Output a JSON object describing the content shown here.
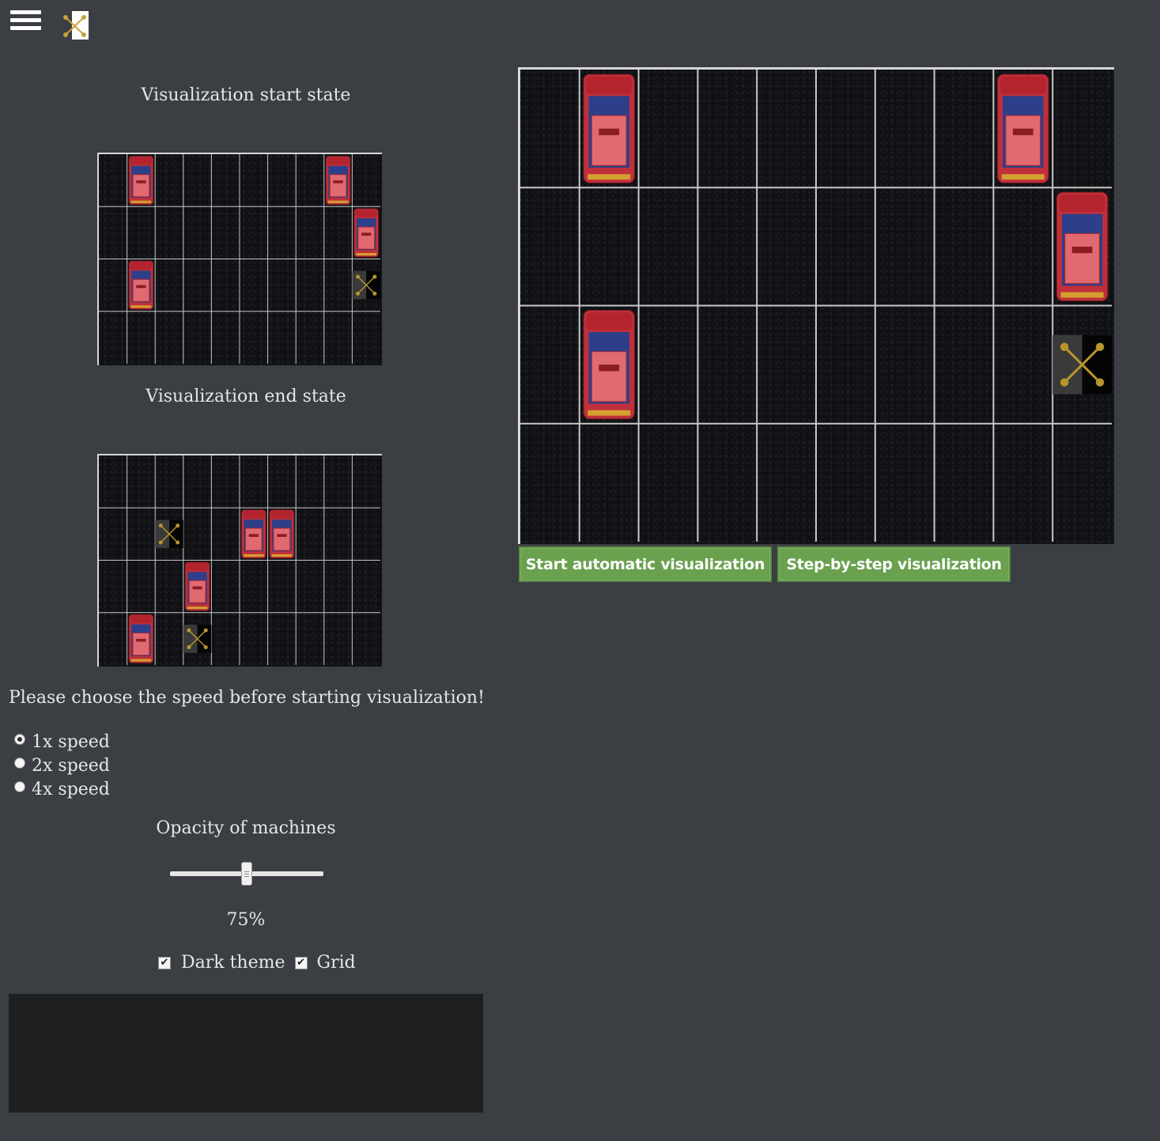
{
  "header": {
    "menu_icon": "hamburger-menu-icon",
    "logo_icon": "app-logo-icon"
  },
  "sidebar": {
    "start_caption": "Visualization start state",
    "end_caption": "Visualization end state",
    "speed_prompt": "Please choose the speed before starting visualization!",
    "speed_options": [
      {
        "label": "1x speed",
        "checked": true
      },
      {
        "label": "2x speed",
        "checked": false
      },
      {
        "label": "4x speed",
        "checked": false
      }
    ],
    "opacity_label": "Opacity of machines",
    "opacity_value": 0.75,
    "opacity_text": "75%",
    "dark_theme_label": "Dark theme",
    "dark_theme_checked": true,
    "grid_label": "Grid",
    "grid_checked": true
  },
  "grid": {
    "cols": 10,
    "rows": 4,
    "start_state": {
      "cars": [
        [
          1,
          0
        ],
        [
          8,
          0
        ],
        [
          9,
          1
        ],
        [
          1,
          2
        ]
      ],
      "machine": [
        9,
        2
      ]
    },
    "end_state": {
      "cars": [
        [
          5,
          1
        ],
        [
          6,
          1
        ],
        [
          3,
          2
        ],
        [
          1,
          3
        ]
      ],
      "machines": [
        [
          2,
          1
        ],
        [
          3,
          3
        ]
      ]
    },
    "current_state": {
      "cars": [
        [
          1,
          0
        ],
        [
          8,
          0
        ],
        [
          9,
          1
        ],
        [
          1,
          2
        ]
      ],
      "machine": [
        9,
        2
      ]
    }
  },
  "controls": {
    "start_auto_label": "Start automatic visualization",
    "step_by_step_label": "Step-by-step visualization"
  },
  "colors": {
    "background": "#3b3e42",
    "button_green": "#69a14f",
    "car_red": "#c0303a",
    "car_blue": "#2d3f8a",
    "machine_gold": "#b8962e"
  }
}
